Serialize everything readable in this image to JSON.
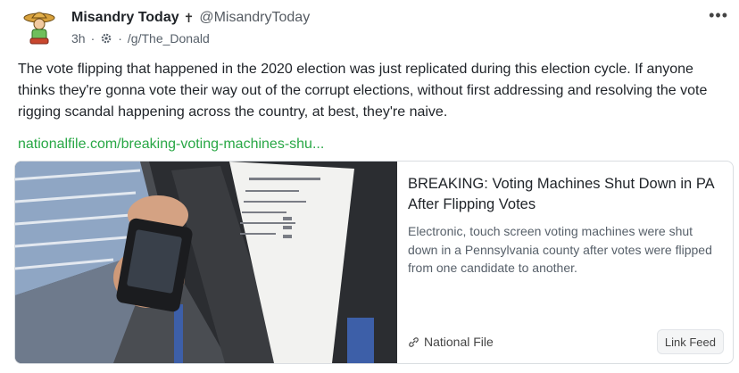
{
  "post": {
    "author": {
      "display_name": "Misandry Today",
      "badge_icon": "cross-icon",
      "handle": "@MisandryToday"
    },
    "meta": {
      "time": "3h",
      "separator": "·",
      "group": "/g/The_Donald"
    },
    "text": "The vote flipping that happened in the 2020 election was just replicated during this election cycle. If anyone thinks they're gonna vote their way out of the corrupt elections, without first addressing and resolving the vote rigging scandal happening across the country, at best, they're naive.",
    "link_text": "nationalfile.com/breaking-voting-machines-shu...",
    "card": {
      "title": "BREAKING: Voting Machines Shut Down in PA After Flipping Votes",
      "description": "Electronic, touch screen voting machines were shut down in a Pennsylvania county after votes were flipped from one candidate to another.",
      "source": "National File",
      "tag": "Link Feed"
    }
  },
  "colors": {
    "link": "#28a745",
    "muted": "#57606a",
    "border": "#d9dde1"
  }
}
